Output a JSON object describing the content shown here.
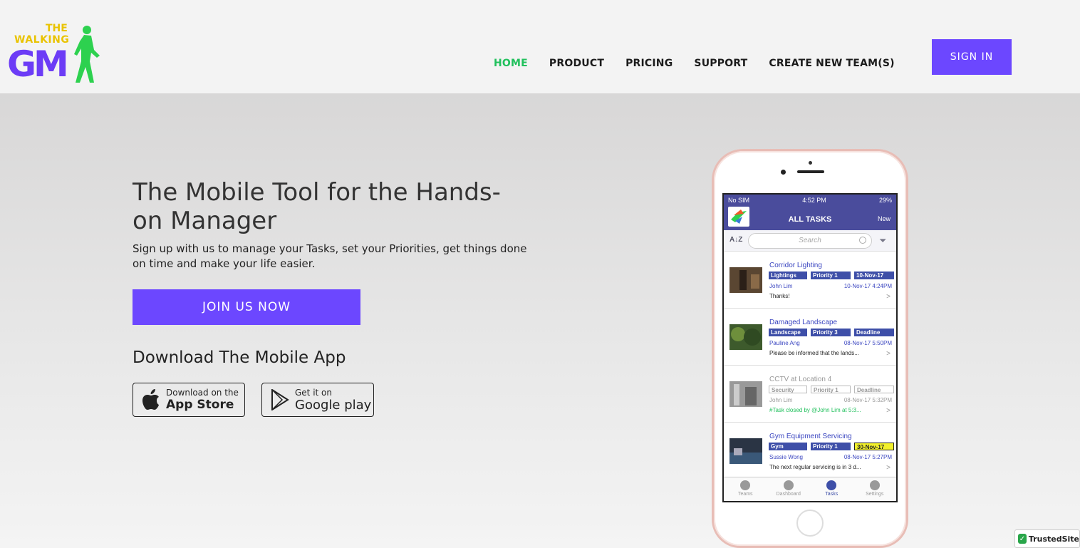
{
  "brand": {
    "line1": "THE",
    "line2": "WALKING",
    "line3": "GM"
  },
  "nav": {
    "items": [
      "HOME",
      "PRODUCT",
      "PRICING",
      "SUPPORT",
      "CREATE NEW TEAM(S)"
    ],
    "active": "HOME"
  },
  "signin_label": "SIGN IN",
  "hero": {
    "headline": "The Mobile Tool for the Hands-on Manager",
    "subtext": "Sign up with us to manage your Tasks, set your Priorities, get things done on time and make your life easier.",
    "join_label": "JOIN US NOW",
    "download_title": "Download The Mobile App",
    "appstore": {
      "small": "Download on the",
      "big": "App Store"
    },
    "googleplay": {
      "small": "Get it on",
      "big": "Google play"
    }
  },
  "phone": {
    "status": {
      "carrier": "No SIM",
      "time": "4:52 PM",
      "battery": "29%"
    },
    "title": "ALL TASKS",
    "new_label": "New",
    "search_placeholder": "Search",
    "tasks": [
      {
        "title": "Corridor Lighting",
        "tags": [
          "Lightings",
          "Priority 1",
          "10-Nov-17"
        ],
        "who": "John Lim",
        "when": "10-Nov-17 4:24PM",
        "msg": "Thanks!"
      },
      {
        "title": "Damaged Landscape",
        "tags": [
          "Landscape",
          "Priority 3",
          "Deadline"
        ],
        "who": "Pauline Ang",
        "when": "08-Nov-17 5:50PM",
        "msg": "Please be informed that the lands..."
      },
      {
        "title": "CCTV at Location 4",
        "tags": [
          "Security",
          "Priority 1",
          "Deadline"
        ],
        "who": "John Lim",
        "when": "08-Nov-17 5:32PM",
        "msg": "#Task closed by @John Lim at 5:3..."
      },
      {
        "title": "Gym Equipment Servicing",
        "tags": [
          "Gym",
          "Priority 1",
          "30-Nov-17"
        ],
        "who": "Sussie Wong",
        "when": "08-Nov-17 5:27PM",
        "msg": "The next regular servicing is in 3 d..."
      }
    ],
    "tabs": [
      "Teams",
      "Dashboard",
      "Tasks",
      "Settings"
    ]
  },
  "trusted": "TrustedSite",
  "colors": {
    "accent": "#6c47ff",
    "active_nav": "#20c05c",
    "app_bar": "#4a4c9c"
  }
}
